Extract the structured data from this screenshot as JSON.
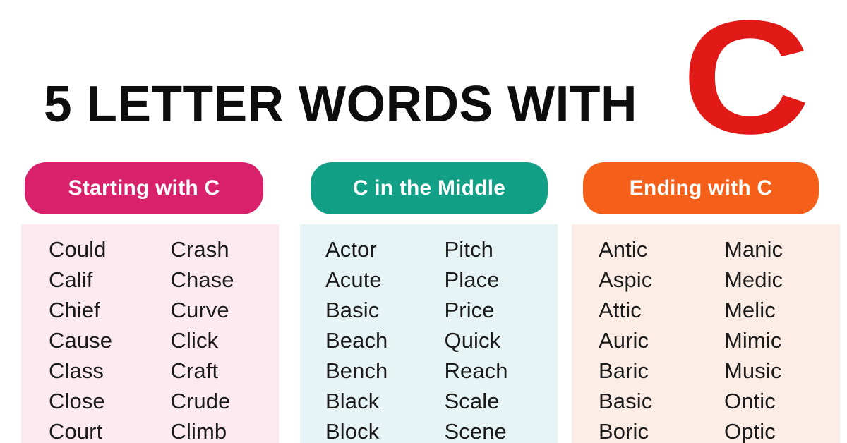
{
  "header": {
    "title": "5 LETTER WORDS WITH",
    "big_letter": "C",
    "big_letter_color": "#e11a17",
    "title_color": "#0d0d0d"
  },
  "sections": [
    {
      "badge_label": "Starting with C",
      "badge_color": "#d9206b",
      "panel_color": "#fceaf0",
      "columns": [
        [
          "Could",
          "Calif",
          "Chief",
          "Cause",
          "Class",
          "Close",
          "Court"
        ],
        [
          "Crash",
          "Chase",
          "Curve",
          "Click",
          "Craft",
          "Crude",
          "Climb"
        ]
      ]
    },
    {
      "badge_label": "C in the Middle",
      "badge_color": "#11a085",
      "panel_color": "#e6f4f6",
      "columns": [
        [
          "Actor",
          "Acute",
          "Basic",
          "Beach",
          "Bench",
          "Black",
          "Block"
        ],
        [
          "Pitch",
          "Place",
          "Price",
          "Quick",
          "Reach",
          "Scale",
          "Scene"
        ]
      ]
    },
    {
      "badge_label": "Ending with C",
      "badge_color": "#f4601a",
      "panel_color": "#fceee6",
      "columns": [
        [
          "Antic",
          "Aspic",
          "Attic",
          "Auric",
          "Baric",
          "Basic",
          "Boric"
        ],
        [
          "Manic",
          "Medic",
          "Melic",
          "Mimic",
          "Music",
          "Ontic",
          "Optic"
        ]
      ]
    }
  ]
}
